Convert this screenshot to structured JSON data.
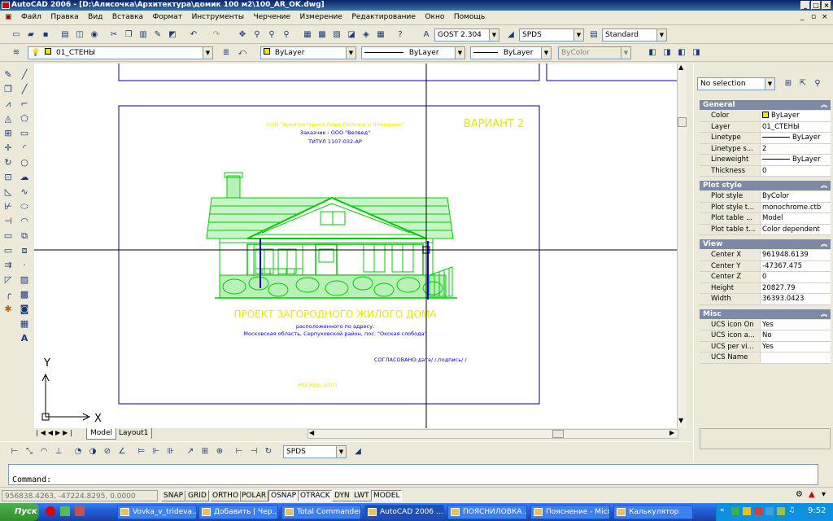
{
  "window": {
    "title": "AutoCAD 2006 - [D:\\Алисочка\\Архитектура\\домик 100 м2\\100_AR_OK.dwg]"
  },
  "menu": [
    "Файл",
    "Правка",
    "Вид",
    "Вставка",
    "Формат",
    "Инструменты",
    "Черчение",
    "Измерение",
    "Редактирование",
    "Окно",
    "Помощь"
  ],
  "toolbar": {
    "textstyle": "GOST 2.304",
    "dimstyle": "SPDS",
    "tablestyle": "Standard",
    "layer": "01_СТЕНЫ",
    "color": "ByLayer",
    "linetype": "ByLayer",
    "lineweight": "ByLayer",
    "plotstyle": "ByColor"
  },
  "drawing": {
    "company": "ООО \"Архитектурное бюро Полозов и помощник\"",
    "customer": "Заказчик : ООО \"Велвед\"",
    "title_block": "ТИТУЛ 1107-032-АР",
    "variant": "ВАРИАНТ 2",
    "project": "ПРОЕКТ ЗАГОРОДНОГО ЖИЛОГО ДОМА",
    "location_label": "расположенного по адресу:",
    "address": "Московская область, Серпуховской район, пос. \"Окская слобода\"",
    "agreed": "СОГЛАСОВАНО:дата/          /,подпись/          /",
    "city_year": "МОСКВА, 2007г.",
    "ucs_x": "X",
    "ucs_y": "Y",
    "colors": {
      "house": "#00cc00",
      "frame": "#0000a0",
      "yellow": "#e8e800",
      "blue": "#0000cc"
    }
  },
  "tabs": [
    "Model",
    "Layout1"
  ],
  "properties": {
    "selection": "No selection",
    "sections": [
      {
        "title": "General",
        "rows": [
          {
            "k": "Color",
            "v": "ByLayer"
          },
          {
            "k": "Layer",
            "v": "01_СТЕНЫ"
          },
          {
            "k": "Linetype",
            "v": "ByLayer"
          },
          {
            "k": "Linetype s...",
            "v": "2"
          },
          {
            "k": "Lineweight",
            "v": "ByLayer"
          },
          {
            "k": "Thickness",
            "v": "0"
          }
        ]
      },
      {
        "title": "Plot style",
        "rows": [
          {
            "k": "Plot style",
            "v": "ByColor"
          },
          {
            "k": "Plot style t...",
            "v": "monochrome.ctb"
          },
          {
            "k": "Plot table ...",
            "v": "Model"
          },
          {
            "k": "Plot table t...",
            "v": "Color dependent"
          }
        ]
      },
      {
        "title": "View",
        "rows": [
          {
            "k": "Center X",
            "v": "961948.6139"
          },
          {
            "k": "Center Y",
            "v": "-47367.475"
          },
          {
            "k": "Center Z",
            "v": "0"
          },
          {
            "k": "Height",
            "v": "20827.79"
          },
          {
            "k": "Width",
            "v": "36393.0423"
          }
        ]
      },
      {
        "title": "Misc",
        "rows": [
          {
            "k": "UCS icon On",
            "v": "Yes"
          },
          {
            "k": "UCS icon a...",
            "v": "No"
          },
          {
            "k": "UCS per vi...",
            "v": "Yes"
          },
          {
            "k": "UCS Name",
            "v": ""
          }
        ]
      }
    ]
  },
  "draw_toolbar": {
    "dimstyle": "SPDS"
  },
  "command": {
    "prompt": "Command:"
  },
  "status": {
    "coords": "956838.4263, -47224.8295, 0.0000",
    "buttons": [
      "SNAP",
      "GRID",
      "ORTHO",
      "POLAR",
      "OSNAP",
      "OTRACK",
      "DYN",
      "LWT",
      "MODEL"
    ],
    "on": [
      "OSNAP",
      "OTRACK",
      "MODEL"
    ]
  },
  "taskbar": {
    "start": "Пуск",
    "tasks": [
      "Vovka_v_trideva...",
      "Добавить | Чер...",
      "Total Commander...",
      "AutoCAD 2006 ...",
      "ПОЯСНИЛОВКА ...",
      "Пояснение - Micro...",
      "Калькулятор"
    ],
    "clock": "9:52"
  }
}
